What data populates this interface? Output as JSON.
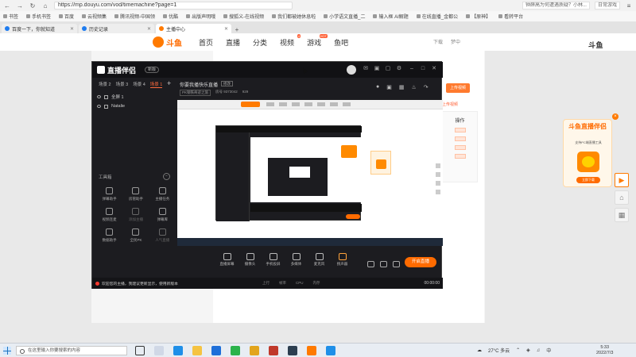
{
  "browser": {
    "url": "https://mp.douyu.com/vod/timemachine?page=1",
    "search_preview": "钟薛高为何遭遇质疑？小林...",
    "extension_text": "日常游戏",
    "bookmarks": [
      "书签",
      "手机书签",
      "百度",
      "云视频集",
      "腾讯视频-中国领",
      "优酷",
      "出版声明哦",
      "搜狐义-在线视频",
      "我们都被她休息啦",
      "小学语文直播_二",
      "输入框 AI解题",
      "在线直播_金都公",
      "【原神】",
      "看转平台",
      "【原神】",
      "看转平台"
    ],
    "tabs": [
      {
        "label": "百度一下，你就知道",
        "active": false
      },
      {
        "label": "历史记录",
        "active": false
      },
      {
        "label": "主播中心",
        "active": true
      }
    ]
  },
  "site": {
    "logo_text": "斗鱼",
    "nav": [
      {
        "label": "首页",
        "hot": ""
      },
      {
        "label": "直播",
        "hot": ""
      },
      {
        "label": "分类",
        "hot": ""
      },
      {
        "label": "视频",
        "hot": "4"
      },
      {
        "label": "游戏",
        "hot": "HOT"
      },
      {
        "label": "鱼吧",
        "hot": ""
      }
    ],
    "header_right": [
      "下载",
      "梦中"
    ],
    "corner_logo": "斗鱼"
  },
  "page": {
    "side_button": "上传视频",
    "side_link": "上传视频",
    "ops_title": "操作"
  },
  "ad": {
    "title": "斗鱼直播伴侣",
    "subtitle": "支持PC端直播工具",
    "button": "立即下载"
  },
  "app": {
    "name": "直播伴侣",
    "badge": "新版",
    "scene_tabs": [
      {
        "label": "场景 2",
        "active": false
      },
      {
        "label": "场景 3",
        "active": false
      },
      {
        "label": "场景 4",
        "active": false
      },
      {
        "label": "场景 1",
        "active": true
      }
    ],
    "sources": [
      "全屏 1",
      "Natalie"
    ],
    "tools_title": "工具箱",
    "tools": [
      {
        "label": "弹幕助手",
        "dim": false
      },
      {
        "label": "房管助手",
        "dim": false
      },
      {
        "label": "主播任务",
        "dim": false
      },
      {
        "label": "视频连麦",
        "dim": false
      },
      {
        "label": "添加主播",
        "dim": true
      },
      {
        "label": "弹幕库",
        "dim": false
      },
      {
        "label": "数据助手",
        "dim": false
      },
      {
        "label": "全民PK",
        "dim": false
      },
      {
        "label": "人气直播",
        "dim": true
      }
    ],
    "room_title": "你要我播快乐直播",
    "room_badge": "修改",
    "room_category": "PK钢铁奇迹之旅",
    "room_id": "房号 9373042",
    "room_heat": "929",
    "controls": [
      "直播屏幕",
      "摄像头",
      "手机投屏",
      "多媒体",
      "麦克风",
      "扬声器"
    ],
    "live_button": "开启直播",
    "status_text": "欢迎您的主播，我建议更新显示，使用新版本",
    "stats": [
      "上行",
      "帧率",
      "CPU",
      "内存"
    ],
    "timer": "00:00:00"
  },
  "taskbar": {
    "search_placeholder": "在这里输入你要搜索的内容",
    "weather": "27°C 多云",
    "lang": "中",
    "time": "5:33",
    "date": "2022/7/3"
  }
}
